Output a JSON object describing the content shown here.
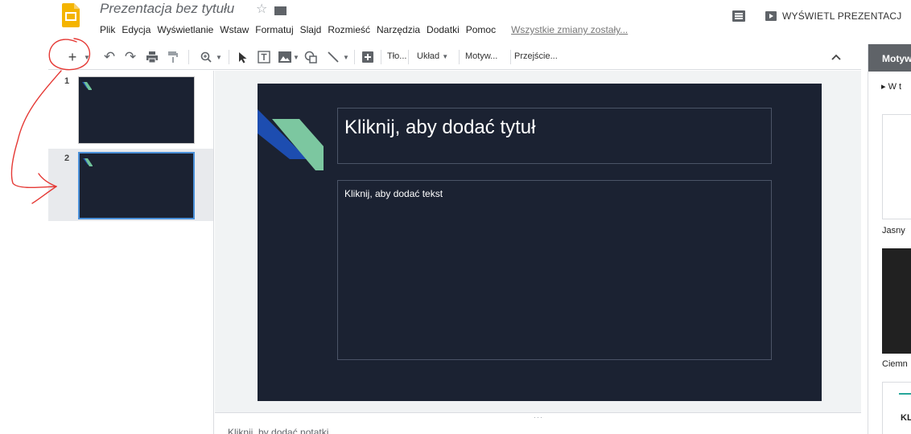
{
  "app": {
    "document_title": "Prezentacja bez tytułu",
    "icons": {
      "logo": "slides-logo-icon",
      "star": "star-icon",
      "folder": "folder-icon",
      "comments": "comments-icon",
      "present": "present-icon"
    },
    "brand_color": "#f4b400"
  },
  "menu": {
    "items": [
      "Plik",
      "Edycja",
      "Wyświetlanie",
      "Wstaw",
      "Formatuj",
      "Slajd",
      "Rozmieść",
      "Narzędzia",
      "Dodatki",
      "Pomoc"
    ],
    "save_status": "Wszystkie zmiany zostały..."
  },
  "header": {
    "present_label": "WYŚWIETL PREZENTACJ"
  },
  "toolbar": {
    "new_slide": "+",
    "undo": "↶",
    "redo": "↷",
    "print": "print-icon",
    "paint_format": "paint-format-icon",
    "zoom": "zoom-icon",
    "select": "cursor-icon",
    "textbox": "textbox-icon",
    "image": "image-icon",
    "shape": "shape-icon",
    "line": "line-icon",
    "comment": "add-comment-icon",
    "background_label": "Tło...",
    "layout_label": "Układ",
    "theme_label": "Motyw...",
    "transition_label": "Przejście...",
    "collapse": "chevron-up-icon"
  },
  "filmstrip": {
    "slides": [
      {
        "number": "1",
        "selected": false
      },
      {
        "number": "2",
        "selected": true
      }
    ]
  },
  "slide": {
    "title_placeholder": "Kliknij, aby dodać tytuł",
    "body_placeholder": "Kliknij, aby dodać tekst",
    "background_color": "#1b2232"
  },
  "notes": {
    "handle": "···",
    "placeholder": "Kliknij, by dodać notatki"
  },
  "theme_panel": {
    "title": "Motyw",
    "subtitle": "▸ W t",
    "themes": [
      {
        "label": "Jasny"
      },
      {
        "label": "Ciemn"
      },
      {
        "label": "KL"
      }
    ]
  },
  "annotation": {
    "color": "#e53935"
  }
}
